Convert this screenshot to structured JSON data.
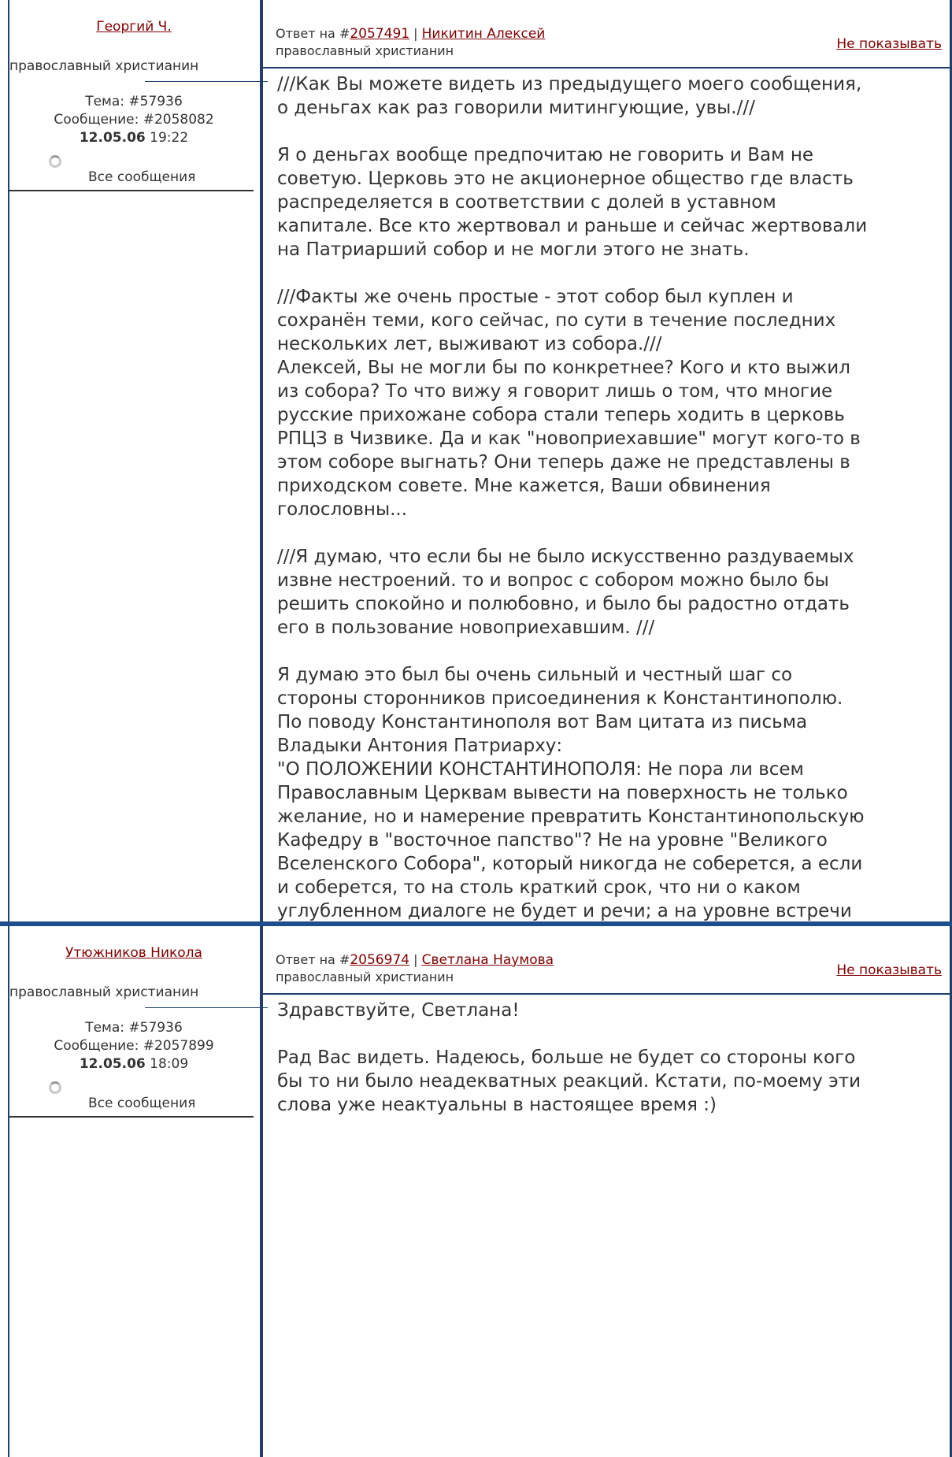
{
  "posts": [
    {
      "author": "Георгий Ч.",
      "role": "православный христианин",
      "topic": "Тема: #57936",
      "message": "Сообщение: #2058082",
      "date": "12.05.06",
      "time": "19:22",
      "all_messages": "Все сообщения",
      "reply_prefix": "Ответ на #",
      "reply_id": "2057491",
      "reply_sep": " | ",
      "reply_author": "Никитин Алексей",
      "reply_role": " православный христианин",
      "hide": "Не показывать",
      "body": "///Как Вы можете видеть из предыдущего моего сообщения,\nо деньгах как раз говорили митингующие, увы.///\n\nЯ о деньгах вообще предпочитаю не говорить и Вам не\nсоветую. Церковь это не акционерное общество где власть\nраспределяется в соответствии с долей в уставном\nкапитале. Все кто жертвовал и раньше и сейчас жертвовали\nна Патриарший собор и не могли этого не знать.\n\n///Факты же очень простые - этот собор был куплен и\nсохранён теми, кого сейчас, по сути в течение последних\nнескольких лет, выживают из собора.///\nАлексей, Вы не могли бы по конкретнее? Кого и кто выжил\nиз собора? То что вижу я говорит лишь о том, что многие\nрусские прихожане собора стали теперь ходить в церковь\nРПЦЗ в Чизвике. Да и как \"новоприехавшие\" могут кого-то в\nэтом соборе выгнать? Они теперь даже не представлены в\nприходском совете. Мне кажется, Ваши обвинения\nголословны...\n\n///Я думаю, что если бы не было искусственно раздуваемых\nизвне нестроений. то и вопрос с собором можно было бы\nрешить спокойно и полюбовно, и было бы радостно отдать\nего в пользование новоприехавшим. ///\n\nЯ думаю это был бы очень сильный и честный шаг со\nстороны сторонников присоединения к Константинополю.\nПо поводу Константинополя вот Вам цитата из письма\nВладыки Антония Патриарху:\n\"О ПОЛОЖЕНИИ КОНСТАНТИНОПОЛЯ: Не пора ли всем\nПравославным Церквам вывести на поверхность не только\nжелание, но и намерение превратить Константинопольскую\nКафедру в \"восточное папство\"? Не на уровне \"Великого\nВселенского Собора\", который никогда не соберется, а если\nи соберется, то на столь краткий срок, что ни о каком\nуглубленном диалоге не будет и речи; а на уровне встречи\nПатриархов с небольшим числом Богословов. Притязания\nКонстантинополя не волнуют Запад, он привык к Папству, и\nготов принять (да и принимает) Константинополь как\nавторизованного представителя \"вселенскости\". \"\n\nВы уверены что Владыка Антоний видел свою епархию\nчастью \"второго папства\"?"
    },
    {
      "author": "Утюжников Никола",
      "role": "православный христианин",
      "topic": "Тема: #57936",
      "message": "Сообщение: #2057899",
      "date": "12.05.06",
      "time": "18:09",
      "all_messages": "Все сообщения",
      "reply_prefix": "Ответ на #",
      "reply_id": "2056974",
      "reply_sep": " | ",
      "reply_author": "Светлана Наумова",
      "reply_role": " православный христианин",
      "hide": "Не показывать",
      "body": "Здравствуйте, Светлана!\n\nРад Вас видеть. Надеюсь, больше не будет со стороны кого\nбы то ни было неадекватных реакций. Кстати, по-моему эти\nслова уже неактуальны в настоящее время :)"
    }
  ]
}
